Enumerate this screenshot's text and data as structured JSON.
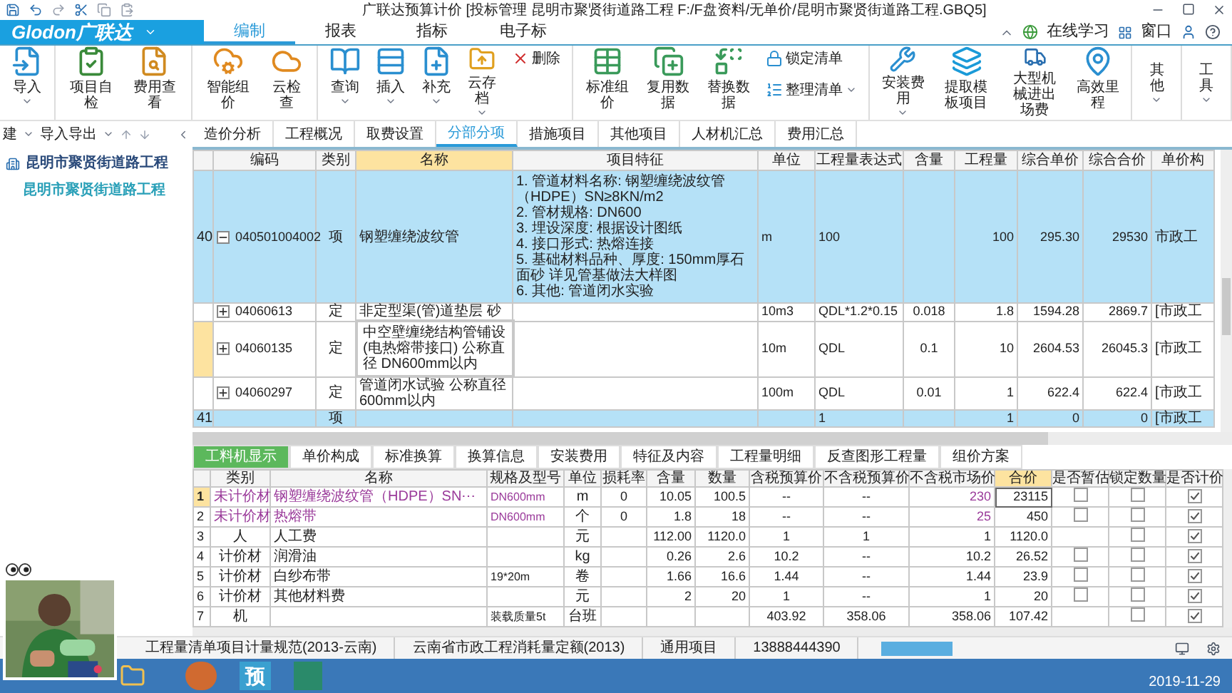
{
  "title_bar": {
    "title": "广联达预算计价 [投标管理 昆明市聚贤街道路工程 F:/F盘资料/无单价/昆明市聚贤街道路工程.GBQ5]"
  },
  "logo": "Glodon广联达",
  "menu_tabs": [
    {
      "label": "编制",
      "selected": true
    },
    {
      "label": "报表",
      "selected": false
    },
    {
      "label": "指标",
      "selected": false
    },
    {
      "label": "电子标",
      "selected": false
    }
  ],
  "top_right": {
    "online": "在线学习",
    "window": "窗口"
  },
  "ribbon": [
    [
      {
        "label": "导入",
        "kind": "large",
        "dropdown": true
      }
    ],
    [
      {
        "label": "项目自检",
        "kind": "large",
        "dropdown": false
      },
      {
        "label": "费用查看",
        "kind": "large",
        "dropdown": false
      }
    ],
    [
      {
        "label": "智能组价",
        "kind": "large",
        "dropdown": false
      },
      {
        "label": "云检查",
        "kind": "large",
        "dropdown": false
      }
    ],
    [
      {
        "label": "查询",
        "kind": "large",
        "dropdown": true
      },
      {
        "label": "插入",
        "kind": "large",
        "dropdown": true
      },
      {
        "label": "补充",
        "kind": "large",
        "dropdown": true
      },
      {
        "label": "云存档",
        "kind": "large",
        "dropdown": true
      },
      {
        "label": "删除",
        "kind": "small",
        "dropdown": false
      }
    ],
    [
      {
        "label": "标准组价",
        "kind": "large",
        "dropdown": false
      },
      {
        "label": "复用数据",
        "kind": "large",
        "dropdown": false
      },
      {
        "label": "替换数据",
        "kind": "large",
        "dropdown": false
      },
      {
        "label": "锁定清单",
        "kind": "small",
        "dropdown": false
      },
      {
        "label": "整理清单",
        "kind": "small",
        "dropdown": true
      }
    ],
    [
      {
        "label": "安装费用",
        "kind": "large",
        "dropdown": true
      },
      {
        "label": "提取模板项目",
        "kind": "large",
        "dropdown": false
      },
      {
        "label": "大型机械进出场费",
        "kind": "large",
        "dropdown": false
      },
      {
        "label": "高效里程",
        "kind": "large",
        "dropdown": false
      }
    ],
    [
      {
        "label": "其他",
        "kind": "large",
        "dropdown": true
      }
    ],
    [
      {
        "label": "工具",
        "kind": "large",
        "dropdown": true
      }
    ]
  ],
  "left_toolbar": {
    "new": "建",
    "import_export": "导入导出"
  },
  "project_tree": [
    {
      "label": "昆明市聚贤街道路工程",
      "selected": false,
      "children": [
        {
          "label": "昆明市聚贤街道路工程",
          "selected": true
        }
      ]
    }
  ],
  "work_tabs": [
    {
      "label": "造价分析",
      "selected": false
    },
    {
      "label": "工程概况",
      "selected": false
    },
    {
      "label": "取费设置",
      "selected": false
    },
    {
      "label": "分部分项",
      "selected": true
    },
    {
      "label": "措施项目",
      "selected": false
    },
    {
      "label": "其他项目",
      "selected": false
    },
    {
      "label": "人材机汇总",
      "selected": false
    },
    {
      "label": "费用汇总",
      "selected": false
    }
  ],
  "bill_table": {
    "columns": [
      {
        "label": "编码",
        "selected": false
      },
      {
        "label": "类别",
        "selected": false
      },
      {
        "label": "名称",
        "selected": true
      },
      {
        "label": "项目特征",
        "selected": false
      },
      {
        "label": "单位",
        "selected": false
      },
      {
        "label": "工程量表达式",
        "selected": false
      },
      {
        "label": "含量",
        "selected": false
      },
      {
        "label": "工程量",
        "selected": false
      },
      {
        "label": "综合单价",
        "selected": false
      },
      {
        "label": "综合合价",
        "selected": false
      },
      {
        "label": "单价构",
        "selected": false
      }
    ],
    "rows": [
      {
        "kind": "bill",
        "selected": false,
        "num": "40",
        "expanded": true,
        "code": "040501004002",
        "type": "项",
        "name": "钢塑缠绕波纹管",
        "feature": [
          "1. 管道材料名称: 钢塑缠绕波纹管（HDPE）SN≥8KN/m2",
          "2. 管材规格: DN600",
          "3. 埋设深度: 根据设计图纸",
          "4. 接口形式: 热熔连接",
          "5. 基础材料品种、厚度: 150mm厚石面砂 详见管基做法大样图",
          "6. 其他: 管道闭水实验"
        ],
        "unit": "m",
        "expr": "100",
        "qty": "100",
        "price": "295.30",
        "total": "29530",
        "fee": "市政工"
      },
      {
        "kind": "quota",
        "selected": false,
        "expanded": false,
        "code": "04060613",
        "type": "定",
        "name": "非定型渠(管)道垫层 砂",
        "unit": "10m3",
        "expr": "QDL*1.2*0.15",
        "content": "0.018",
        "qty": "1.8",
        "price": "1594.28",
        "total": "2869.7",
        "fee": "[市政工"
      },
      {
        "kind": "quota",
        "selected": true,
        "expanded": false,
        "code": "04060135",
        "type": "定",
        "name": "中空壁缠绕结构管铺设(电热熔带接口) 公称直径 DN600mm以内",
        "unit": "10m",
        "expr": "QDL",
        "content": "0.1",
        "qty": "10",
        "price": "2604.53",
        "total": "26045.3",
        "fee": "[市政工"
      },
      {
        "kind": "quota",
        "selected": false,
        "expanded": false,
        "code": "04060297",
        "type": "定",
        "name": "管道闭水试验 公称直径600mm以内",
        "unit": "100m",
        "expr": "QDL",
        "content": "0.01",
        "qty": "1",
        "price": "622.4",
        "total": "622.4",
        "fee": "[市政工"
      },
      {
        "kind": "bill",
        "selected": false,
        "num": "41",
        "type": "项",
        "expr": "1",
        "qty": "1",
        "price": "0",
        "total": "0",
        "fee": "[市政工"
      }
    ]
  },
  "detail_tabs": [
    {
      "label": "工料机显示",
      "selected": true
    },
    {
      "label": "单价构成",
      "selected": false
    },
    {
      "label": "标准换算",
      "selected": false
    },
    {
      "label": "换算信息",
      "selected": false
    },
    {
      "label": "安装费用",
      "selected": false
    },
    {
      "label": "特征及内容",
      "selected": false
    },
    {
      "label": "工程量明细",
      "selected": false
    },
    {
      "label": "反查图形工程量",
      "selected": false
    },
    {
      "label": "组价方案",
      "selected": false
    }
  ],
  "resource_table": {
    "columns": [
      {
        "label": "类别",
        "selected": false
      },
      {
        "label": "名称",
        "selected": false
      },
      {
        "label": "规格及型号",
        "selected": false
      },
      {
        "label": "单位",
        "selected": false
      },
      {
        "label": "损耗率",
        "selected": false
      },
      {
        "label": "含量",
        "selected": false
      },
      {
        "label": "数量",
        "selected": false
      },
      {
        "label": "含税预算价",
        "selected": false
      },
      {
        "label": "不含税预算价",
        "selected": false
      },
      {
        "label": "不含税市场价",
        "selected": false
      },
      {
        "label": "合价",
        "selected": true
      },
      {
        "label": "是否暂估",
        "selected": false
      },
      {
        "label": "锁定数量",
        "selected": false
      },
      {
        "label": "是否计价",
        "selected": false
      }
    ],
    "rows": [
      {
        "num": "1",
        "kind": "unpriced",
        "selected": true,
        "category": "未计价材",
        "name": "钢塑缠绕波纹管（HDPE）SN⋯",
        "spec": "DN600mm",
        "unit": "m",
        "loss": "0",
        "content": "10.05",
        "qty": "100.5",
        "tax_budget": "--",
        "notax_budget": "--",
        "market": "230",
        "total": "23115",
        "estimate": false,
        "locked": false,
        "priced": true
      },
      {
        "num": "2",
        "kind": "unpriced",
        "selected": false,
        "category": "未计价材",
        "name": "热熔带",
        "spec": "DN600mm",
        "unit": "个",
        "loss": "0",
        "content": "1.8",
        "qty": "18",
        "tax_budget": "--",
        "notax_budget": "--",
        "market": "25",
        "total": "450",
        "estimate": false,
        "locked": false,
        "priced": true
      },
      {
        "num": "3",
        "kind": "normal",
        "selected": false,
        "category": "人",
        "name": "人工费",
        "unit": "元",
        "content": "112.00",
        "qty": "1120.0",
        "tax_budget": "1",
        "notax_budget": "1",
        "market": "1",
        "total": "1120.0",
        "locked": false,
        "priced": true
      },
      {
        "num": "4",
        "kind": "normal",
        "selected": false,
        "category": "计价材",
        "name": "润滑油",
        "unit": "kg",
        "content": "0.26",
        "qty": "2.6",
        "tax_budget": "10.2",
        "notax_budget": "--",
        "market": "10.2",
        "total": "26.52",
        "estimate": false,
        "locked": false,
        "priced": true
      },
      {
        "num": "5",
        "kind": "normal",
        "selected": false,
        "category": "计价材",
        "name": "白纱布带",
        "spec": "19*20m",
        "unit": "卷",
        "content": "1.66",
        "qty": "16.6",
        "tax_budget": "1.44",
        "notax_budget": "--",
        "market": "1.44",
        "total": "23.9",
        "estimate": false,
        "locked": false,
        "priced": true
      },
      {
        "num": "6",
        "kind": "normal",
        "selected": false,
        "category": "计价材",
        "name": "其他材料费",
        "unit": "元",
        "content": "2",
        "qty": "20",
        "tax_budget": "1",
        "notax_budget": "--",
        "market": "1",
        "total": "20",
        "estimate": false,
        "locked": false,
        "priced": true
      },
      {
        "num": "7",
        "kind": "normal",
        "selected": false,
        "category": "机",
        "spec": "装载质量5t",
        "unit": "台班",
        "tax_budget": "403.92",
        "notax_budget": "358.06",
        "market": "358.06",
        "total": "107.42",
        "locked": false,
        "priced": true
      }
    ]
  },
  "status_bar": [
    "工程量清单项目计量规范(2013-云南)",
    "云南省市政工程消耗量定额(2013)",
    "通用项目",
    "13888444390"
  ],
  "taskbar": {
    "app_letter": "预",
    "date": "2019-11-29"
  }
}
